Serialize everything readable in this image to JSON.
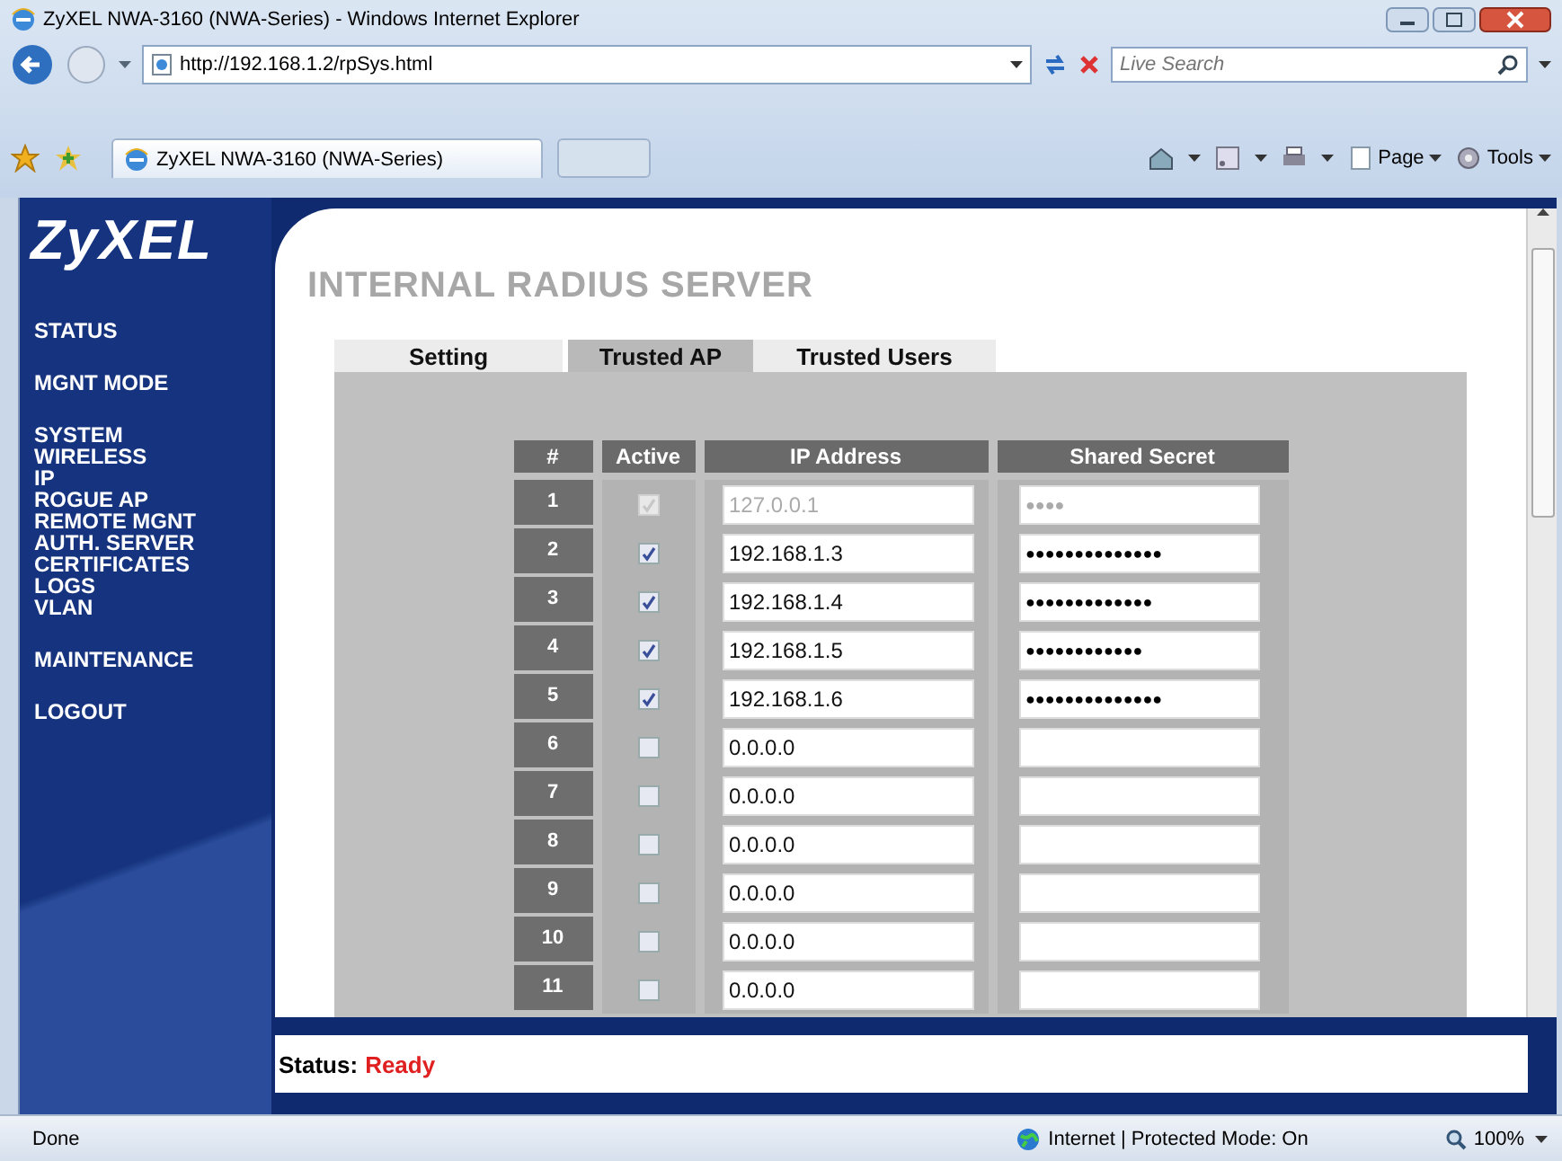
{
  "window": {
    "title": "ZyXEL NWA-3160 (NWA-Series) - Windows Internet Explorer"
  },
  "address_bar": {
    "url": "http://192.168.1.2/rpSys.html"
  },
  "search": {
    "placeholder": "Live Search"
  },
  "browser_tabs": [
    {
      "label": "ZyXEL NWA-3160 (NWA-Series)",
      "selected": true
    }
  ],
  "command_bar": [
    {
      "kind": "home"
    },
    {
      "kind": "feeds"
    },
    {
      "kind": "print"
    },
    {
      "kind": "page",
      "label": "Page"
    },
    {
      "kind": "tools",
      "label": "Tools"
    }
  ],
  "logo": "ZyXEL",
  "sidebar": {
    "groups": [
      [
        "STATUS"
      ],
      [
        "MGNT MODE"
      ],
      [
        "SYSTEM",
        "WIRELESS",
        "IP",
        "ROGUE AP",
        "REMOTE MGNT",
        "AUTH. SERVER",
        "CERTIFICATES",
        "LOGS",
        "VLAN"
      ],
      [
        "MAINTENANCE"
      ],
      [
        "LOGOUT"
      ]
    ]
  },
  "page_title": "INTERNAL RADIUS SERVER",
  "tabs": [
    {
      "label": "Setting",
      "selected": false
    },
    {
      "label": "Trusted AP",
      "selected": true
    },
    {
      "label": "Trusted Users",
      "selected": false
    }
  ],
  "table": {
    "columns": [
      "#",
      "Active",
      "IP Address",
      "Shared Secret"
    ],
    "rows": [
      {
        "number": "1",
        "active": true,
        "disabled": true,
        "ip": "127.0.0.1",
        "secret": "●●●●"
      },
      {
        "number": "2",
        "active": true,
        "disabled": false,
        "ip": "192.168.1.3",
        "secret": "●●●●●●●●●●●●●●"
      },
      {
        "number": "3",
        "active": true,
        "disabled": false,
        "ip": "192.168.1.4",
        "secret": "●●●●●●●●●●●●●"
      },
      {
        "number": "4",
        "active": true,
        "disabled": false,
        "ip": "192.168.1.5",
        "secret": "●●●●●●●●●●●●"
      },
      {
        "number": "5",
        "active": true,
        "disabled": false,
        "ip": "192.168.1.6",
        "secret": "●●●●●●●●●●●●●●"
      },
      {
        "number": "6",
        "active": false,
        "disabled": false,
        "ip": "0.0.0.0"
      },
      {
        "number": "7",
        "active": false,
        "disabled": false,
        "ip": "0.0.0.0"
      },
      {
        "number": "8",
        "active": false,
        "disabled": false,
        "ip": "0.0.0.0"
      },
      {
        "number": "9",
        "active": false,
        "disabled": false,
        "ip": "0.0.0.0"
      },
      {
        "number": "10",
        "active": false,
        "disabled": false,
        "ip": "0.0.0.0"
      },
      {
        "number": "11",
        "active": false,
        "disabled": false,
        "ip": "0.0.0.0"
      }
    ]
  },
  "page_status": {
    "label": "Status:",
    "value": "Ready"
  },
  "status_bar": {
    "text": "Done",
    "zone": "Internet | Protected Mode: On",
    "zoom": "100%"
  }
}
